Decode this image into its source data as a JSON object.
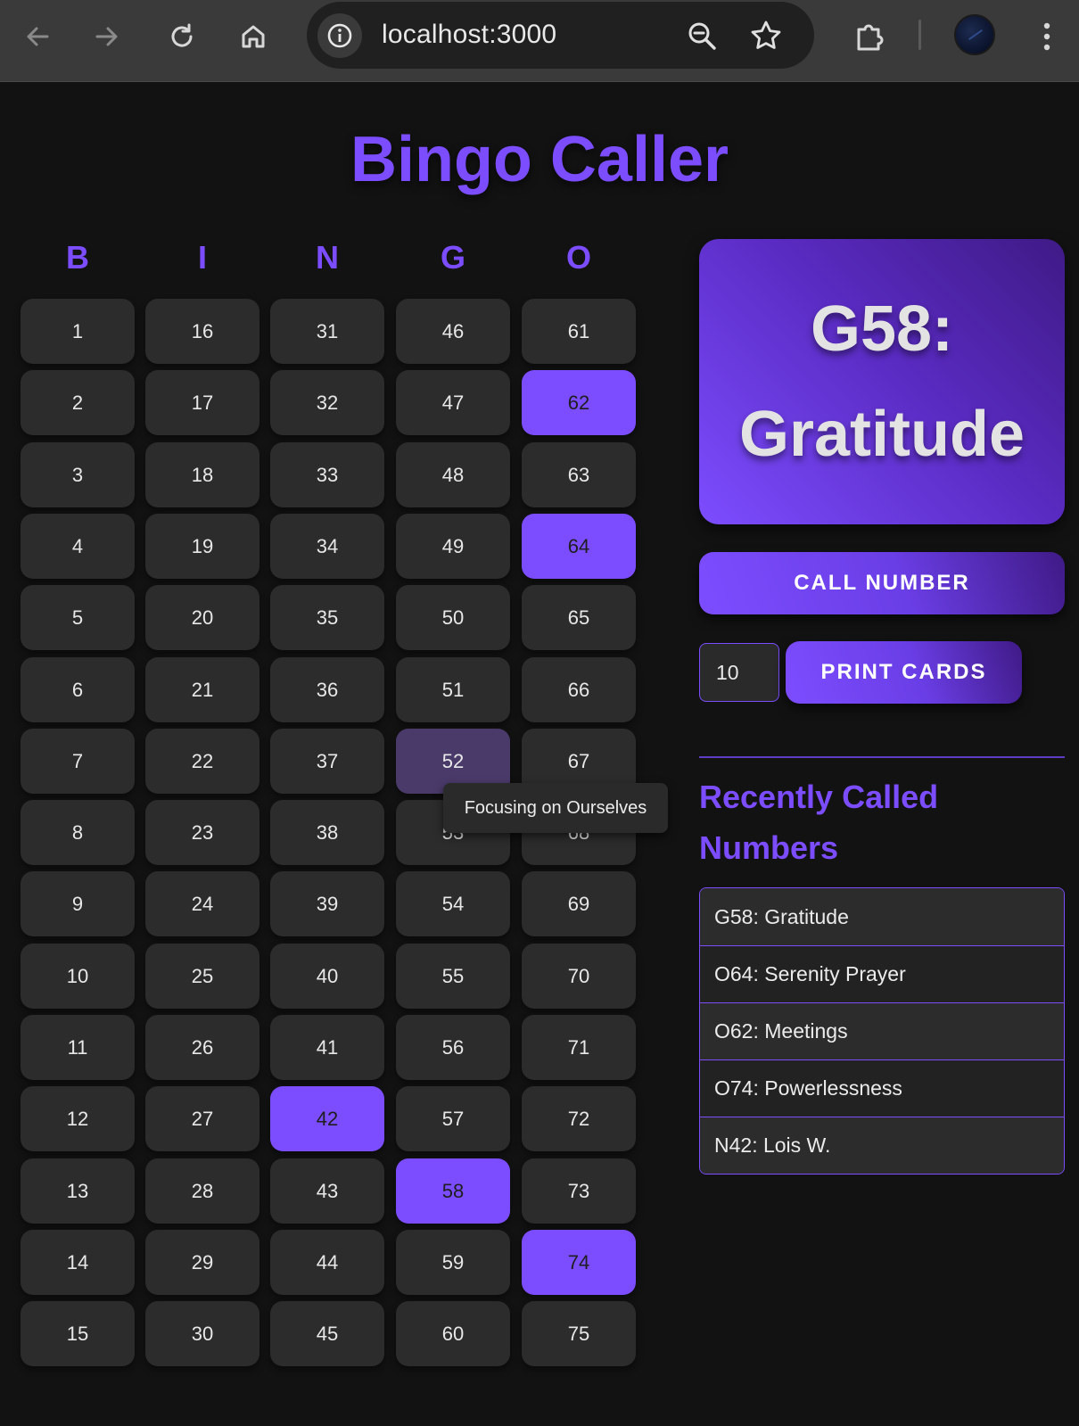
{
  "browser": {
    "url": "localhost:3000",
    "icons": [
      "back-arrow-icon",
      "forward-arrow-icon",
      "reload-icon",
      "home-icon",
      "site-info-icon",
      "zoom-icon",
      "bookmark-star-icon",
      "extensions-icon",
      "profile-avatar",
      "kebab-menu-icon"
    ]
  },
  "page": {
    "title": "Bingo Caller"
  },
  "board": {
    "headers": [
      "B",
      "I",
      "N",
      "G",
      "O"
    ],
    "columns": [
      [
        "1",
        "2",
        "3",
        "4",
        "5",
        "6",
        "7",
        "8",
        "9",
        "10",
        "11",
        "12",
        "13",
        "14",
        "15"
      ],
      [
        "16",
        "17",
        "18",
        "19",
        "20",
        "21",
        "22",
        "23",
        "24",
        "25",
        "26",
        "27",
        "28",
        "29",
        "30"
      ],
      [
        "31",
        "32",
        "33",
        "34",
        "35",
        "36",
        "37",
        "38",
        "39",
        "40",
        "41",
        "42",
        "43",
        "44",
        "45"
      ],
      [
        "46",
        "47",
        "48",
        "49",
        "50",
        "51",
        "52",
        "53",
        "54",
        "55",
        "56",
        "57",
        "58",
        "59",
        "60"
      ],
      [
        "61",
        "62",
        "63",
        "64",
        "65",
        "66",
        "67",
        "68",
        "69",
        "70",
        "71",
        "72",
        "73",
        "74",
        "75"
      ]
    ],
    "called": [
      "42",
      "58",
      "62",
      "64",
      "74"
    ],
    "hovered": "52",
    "tooltip": "Focusing on Ourselves"
  },
  "current_call": {
    "line1": "G58:",
    "line2": "Gratitude"
  },
  "controls": {
    "call_label": "CALL NUMBER",
    "card_count": "10",
    "print_label": "PRINT CARDS"
  },
  "recent": {
    "title": "Recently Called Numbers",
    "items": [
      "G58: Gratitude",
      "O64: Serenity Prayer",
      "O62: Meetings",
      "O74: Powerlessness",
      "N42: Lois W."
    ]
  },
  "colors": {
    "accent": "#7c4dff",
    "background": "#121212",
    "cell": "#2c2c2c",
    "hover_cell": "#4a3a6a"
  }
}
